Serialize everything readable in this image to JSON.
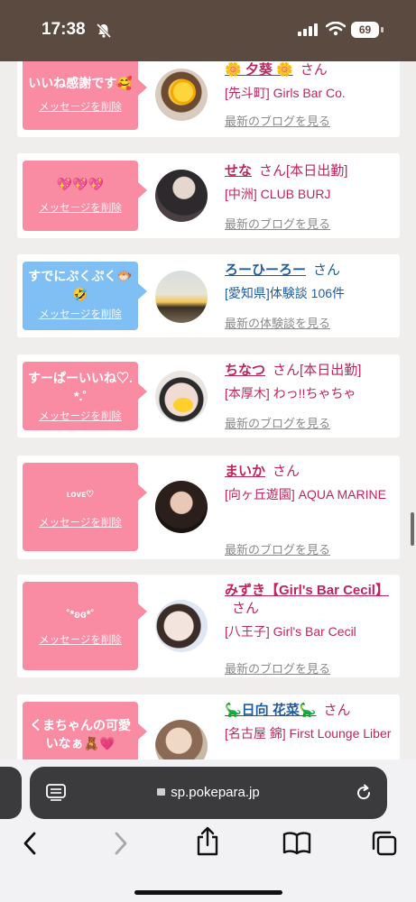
{
  "status_bar": {
    "time": "17:38",
    "battery": "69"
  },
  "browser": {
    "url": "sp.pokepara.jp"
  },
  "cards": [
    {
      "message": "いいね感謝です🥰",
      "delete_label": "メッセージを削除",
      "name": "🌼 夕葵 🌼",
      "san": "さん",
      "tag": "",
      "shop": "[先斗町] Girls Bar Co.",
      "blog_link": "最新のブログを見る"
    },
    {
      "message": "💖💖💖",
      "delete_label": "メッセージを削除",
      "name": "せな",
      "san": "さん",
      "tag": "[本日出勤]",
      "shop": "[中洲] CLUB BURJ",
      "blog_link": "最新のブログを見る"
    },
    {
      "message": "すでにぷくぷく🐡🤣",
      "delete_label": "メッセージを削除",
      "name": "ろーひーろー",
      "san": "さん",
      "tag": "",
      "shop": "[愛知県]体験談 106件",
      "blog_link": "最新の体験談を見る"
    },
    {
      "message": "すーぱーいいね♡.*.˚",
      "delete_label": "メッセージを削除",
      "name": "ちなつ",
      "san": "さん",
      "tag": "[本日出勤]",
      "shop": "[本厚木] わっ!!ちゃちゃ",
      "blog_link": "最新のブログを見る"
    },
    {
      "message": "ʟᴏᴠᴇ♡",
      "delete_label": "メッセージを削除",
      "name": "まいか",
      "san": "さん",
      "tag": "",
      "shop": "[向ヶ丘遊園] AQUA MARINE",
      "blog_link": "最新のブログを見る"
    },
    {
      "message": "˚*ʚɞ*˚",
      "delete_label": "メッセージを削除",
      "name": "みずき【Girl's Bar Cecil】",
      "san": "さん",
      "tag": "",
      "shop": "[八王子] Girl's Bar Cecil",
      "blog_link": "最新のブログを見る"
    },
    {
      "message": "くまちゃんの可愛いなぁ🧸💗",
      "delete_label": "",
      "name": "🦕日向 花菜🦕",
      "san": "さん",
      "tag": "",
      "shop": "[名古屋 錦] First Lounge Liber",
      "blog_link": ""
    }
  ],
  "icons": [
    "silent-bell-icon",
    "signal-icon",
    "wifi-icon",
    "tabs-icon",
    "lock-icon",
    "reload-icon",
    "back-icon",
    "forward-icon",
    "share-icon",
    "bookmarks-icon",
    "tab-switcher-icon"
  ]
}
